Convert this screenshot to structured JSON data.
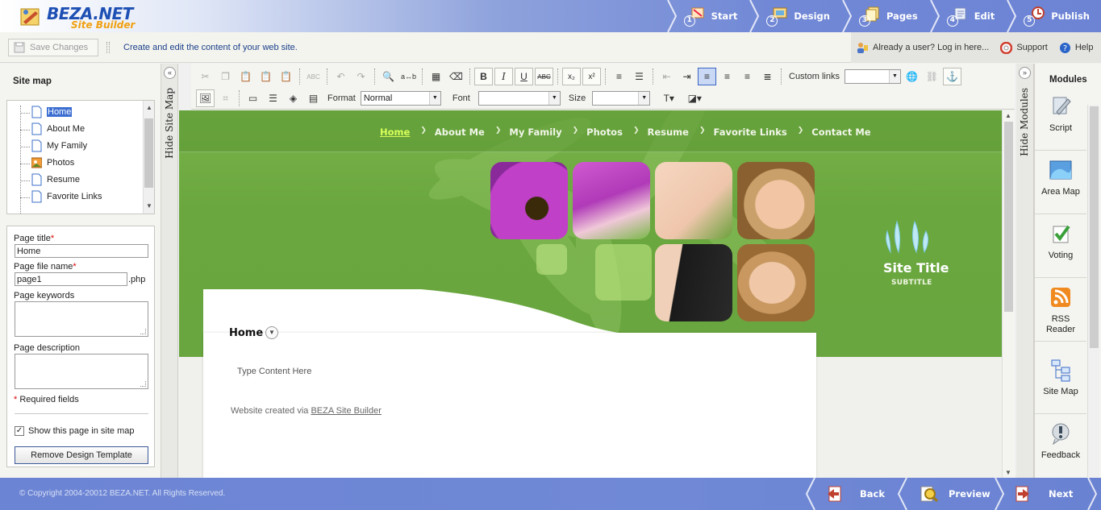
{
  "app": {
    "logo_text": "BEZA.NET",
    "logo_sub": "Site Builder"
  },
  "steps": [
    {
      "num": "1",
      "label": "Start"
    },
    {
      "num": "2",
      "label": "Design"
    },
    {
      "num": "3",
      "label": "Pages"
    },
    {
      "num": "4",
      "label": "Edit"
    },
    {
      "num": "5",
      "label": "Publish"
    }
  ],
  "subbar": {
    "save_label": "Save Changes",
    "description": "Create and edit the content of your web site.",
    "login_label": "Already a user? Log in here...",
    "support_label": "Support",
    "help_label": "Help"
  },
  "sitemap": {
    "title": "Site map",
    "hide_label": "Hide Site Map",
    "pages": [
      {
        "label": "Home",
        "icon": "page-icon",
        "selected": true
      },
      {
        "label": "About Me",
        "icon": "page-icon"
      },
      {
        "label": "My Family",
        "icon": "page-icon"
      },
      {
        "label": "Photos",
        "icon": "photos-icon"
      },
      {
        "label": "Resume",
        "icon": "page-icon"
      },
      {
        "label": "Favorite Links",
        "icon": "page-icon"
      }
    ]
  },
  "form": {
    "page_title_label": "Page title",
    "page_title_value": "Home",
    "file_name_label": "Page file name",
    "file_name_value": "page1",
    "file_ext": ".php",
    "keywords_label": "Page keywords",
    "description_label": "Page description",
    "required_note": "Required fields",
    "required_mark": "*",
    "show_in_sitemap_label": "Show this page in site map",
    "show_in_sitemap_checked": true,
    "remove_template_label": "Remove Design Template"
  },
  "toolbar": {
    "custom_links_label": "Custom links",
    "format_label": "Format",
    "format_value": "Normal",
    "font_label": "Font",
    "font_value": "",
    "size_label": "Size",
    "size_value": "",
    "custom_links_value": ""
  },
  "site": {
    "nav": [
      "Home",
      "About Me",
      "My Family",
      "Photos",
      "Resume",
      "Favorite Links",
      "Contact Me"
    ],
    "title": "Site Title",
    "subtitle": "SUBTITLE",
    "page_heading": "Home",
    "content_placeholder": "Type Content Here",
    "credit_prefix": "Website created via ",
    "credit_link": "BEZA Site Builder",
    "accent_green": "#6aa73e",
    "nav_current_color": "#d8ff5a"
  },
  "modules": {
    "title": "Modules",
    "hide_label": "Hide Modules",
    "items": [
      {
        "label": "Script",
        "icon": "script-icon"
      },
      {
        "label": "Area Map",
        "icon": "area-map-icon"
      },
      {
        "label": "Voting",
        "icon": "voting-icon"
      },
      {
        "label": "RSS Reader",
        "icon": "rss-icon"
      },
      {
        "label": "Site Map",
        "icon": "sitemap-icon"
      },
      {
        "label": "Feedback",
        "icon": "feedback-icon"
      }
    ]
  },
  "footer": {
    "copyright": "© Copyright 2004-20012 BEZA.NET. All Rights Reserved.",
    "back_label": "Back",
    "preview_label": "Preview",
    "next_label": "Next"
  }
}
